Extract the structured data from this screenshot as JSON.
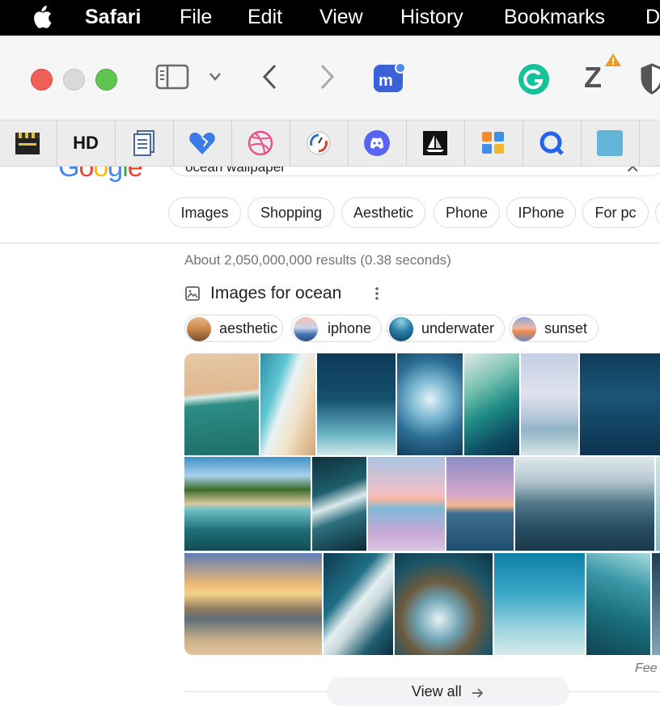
{
  "menubar": {
    "app": "Safari",
    "items": [
      "File",
      "Edit",
      "View",
      "History",
      "Bookmarks",
      "D"
    ]
  },
  "toolbar": {
    "icons": [
      "sidebar-icon",
      "chevron-down-icon",
      "back-icon",
      "forward-icon",
      "mastodon-icon",
      "grammarly-icon",
      "zotero-icon",
      "shield-icon"
    ],
    "zotero_letter": "Z",
    "grammarly_letter": "G"
  },
  "favorites": {
    "hd_label": "HD",
    "icons": [
      "clapper-icon",
      "hd-icon",
      "documents-icon",
      "heart-icon",
      "dribbble-icon",
      "speedtest-icon",
      "discord-icon",
      "sailboat-icon",
      "tiles-icon",
      "q-icon",
      "square-icon",
      "green-icon"
    ]
  },
  "google": {
    "logo": "Google",
    "query": "ocean wallpaper",
    "chips": [
      "Images",
      "Shopping",
      "Aesthetic",
      "Phone",
      "IPhone",
      "For pc"
    ],
    "result_stats": "About 2,050,000,000 results (0.38 seconds)",
    "images_title": "Images for ocean",
    "refinements": [
      {
        "label": "aesthetic"
      },
      {
        "label": "iphone"
      },
      {
        "label": "underwater"
      },
      {
        "label": "sunset"
      }
    ],
    "feedback": "Fee",
    "view_all": "View all"
  },
  "colors": {
    "menubar_bg": "#000000",
    "toolbar_bg": "#f6f6f6",
    "favbar_bg": "#ececec",
    "chip_border": "#dadce0",
    "stats_text": "#70757a"
  }
}
